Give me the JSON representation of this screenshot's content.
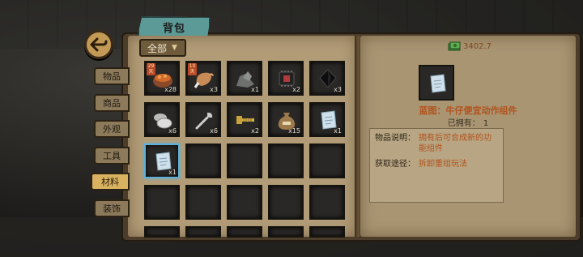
{
  "header": {
    "title": "背包"
  },
  "filter": {
    "label": "全部"
  },
  "side_tabs": [
    {
      "label": "物品"
    },
    {
      "label": "商品"
    },
    {
      "label": "外观"
    },
    {
      "label": "工具"
    },
    {
      "label": "材料"
    },
    {
      "label": "装饰"
    }
  ],
  "active_tab": "材料",
  "inventory": [
    {
      "icon": "food-bowl-icon",
      "qty": "x28",
      "badge": "29天"
    },
    {
      "icon": "chicken-wing-icon",
      "qty": "x3",
      "badge": "10天"
    },
    {
      "icon": "rock-ore-icon",
      "qty": "x1"
    },
    {
      "icon": "microchip-icon",
      "qty": "x2"
    },
    {
      "icon": "dark-crystal-icon",
      "qty": "x3"
    },
    {
      "icon": "metal-plate-icon",
      "qty": "x6"
    },
    {
      "icon": "wrench-icon",
      "qty": "x6"
    },
    {
      "icon": "screw-bolt-icon",
      "qty": "x2"
    },
    {
      "icon": "sack-icon",
      "qty": "x15"
    },
    {
      "icon": "blueprint-paper-icon",
      "qty": "x1"
    },
    {
      "icon": "blueprint-paper-icon",
      "qty": "x1",
      "selected": true
    }
  ],
  "currency": {
    "amount": "3402.7",
    "icon": "cash-icon"
  },
  "detail": {
    "name": "蓝图：牛仔便宜动作组件",
    "owned_label": "已拥有：",
    "owned_value": "1",
    "desc_label": "物品说明：",
    "desc_value": "拥有后可合成新的功能组件",
    "source_label": "获取途径：",
    "source_value": "拆卸重组玩法"
  },
  "colors": {
    "accent": "#b2531d",
    "selected": "#5fb0d8",
    "tab_active": "#d8b261"
  }
}
